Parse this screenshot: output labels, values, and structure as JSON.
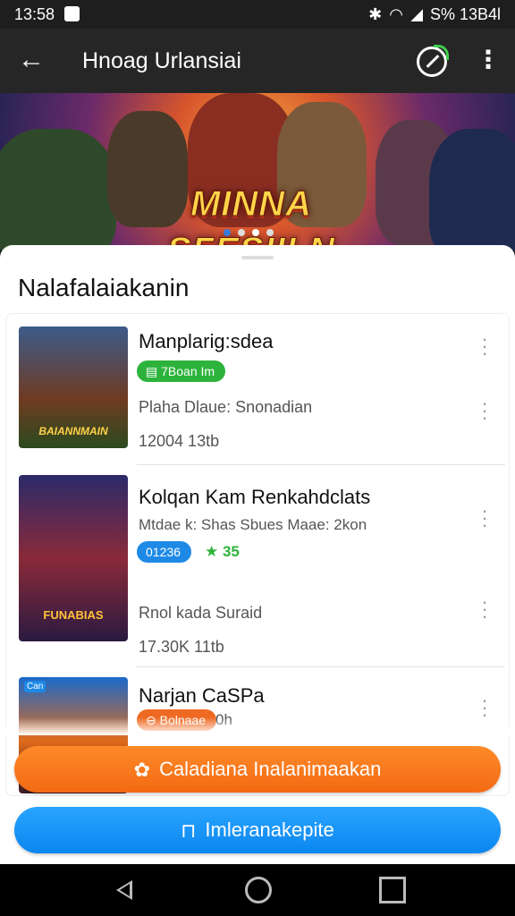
{
  "status_bar": {
    "time": "13:58",
    "right_text": "S% 13B4l"
  },
  "app_bar": {
    "title": "Hnoag Urlansiai",
    "back_icon": "arrow-left-icon",
    "action_icon": "gamepad-launch-icon",
    "more_icon": "more-vert-icon"
  },
  "banner": {
    "title": "MINNA SFESIILN",
    "dots": 4,
    "active_dot": 3
  },
  "sheet": {
    "heading": "Nalafalaiakanin"
  },
  "items": [
    {
      "name": "Manplarig:sdea",
      "badge": "7Boan Im",
      "badge_color": "#2db33c",
      "sub": "Plaha Dlaue: Snonadian",
      "stat": "12004  13tb",
      "thumb_text": "BAIANNMAIN"
    },
    {
      "name": "Kolqan Kam Renkahdclats",
      "sub": "Mtdae k: Shas Sbues    Maae: 2kon",
      "badge": "01236",
      "badge_color": "#1e8ae6",
      "rating": "★ 35",
      "sub2": "Rnol kada Suraid",
      "stat": "17.30K  11tb",
      "thumb_text": "FUNABIAS"
    },
    {
      "name": "Narjan CaSPa",
      "badge": "Bolnaae",
      "badge_color": "#ee6a23",
      "badge_suffix": "0h",
      "thumb_text": "Can"
    }
  ],
  "buttons": {
    "primary": {
      "label": "Caladiana Inalanimaakan",
      "color": "#f26a12",
      "icon": "puzzle-icon"
    },
    "secondary": {
      "label": "Imleranakepite",
      "color": "#0b86f0",
      "icon": "unlock-icon"
    }
  },
  "nav_bar": {
    "back_icon": "nav-back-icon",
    "home_icon": "nav-home-icon",
    "recent_icon": "nav-recent-icon"
  }
}
